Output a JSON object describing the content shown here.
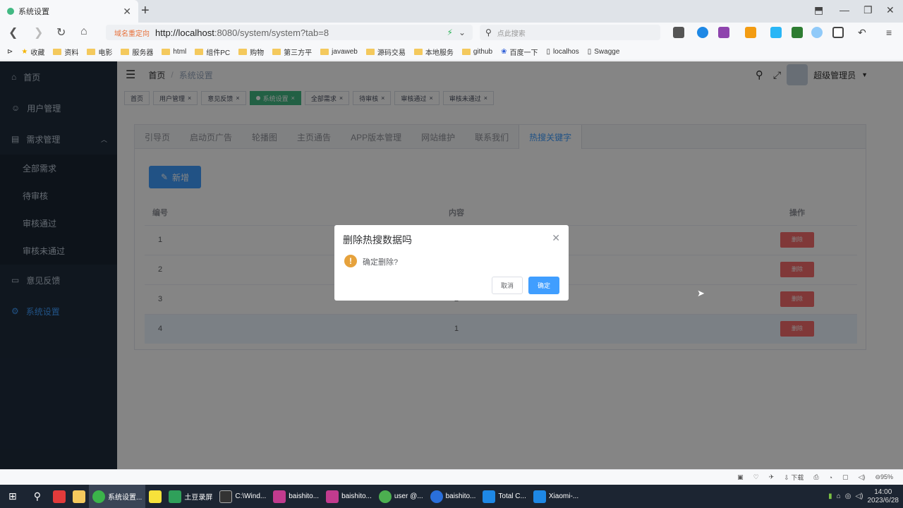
{
  "browser": {
    "tab_title": "系统设置",
    "redirect_label": "域名重定向",
    "url_host": "http://localhost",
    "url_rest": ":8080/system/system?tab=8",
    "search_placeholder": "点此搜索",
    "bookmarks": [
      "收藏",
      "资料",
      "电影",
      "服务器",
      "html",
      "组件PC",
      "购物",
      "第三方平",
      "javaweb",
      "源码交易",
      "本地服务",
      "github",
      "百度一下",
      "localhos",
      "Swagge"
    ]
  },
  "sidebar": {
    "items": [
      {
        "label": "首页",
        "icon": "home-icon"
      },
      {
        "label": "用户管理",
        "icon": "user-icon"
      },
      {
        "label": "需求管理",
        "icon": "document-icon"
      }
    ],
    "sub_items": [
      "全部需求",
      "待审核",
      "审核通过",
      "审核未通过"
    ],
    "items_after": [
      {
        "label": "意见反馈",
        "icon": "chat-icon"
      },
      {
        "label": "系统设置",
        "icon": "settings-icon"
      }
    ]
  },
  "navbar": {
    "breadcrumb_home": "首页",
    "breadcrumb_sep": "/",
    "breadcrumb_current": "系统设置",
    "user_name": "超级管理员"
  },
  "tags": [
    "首页",
    "用户管理",
    "意见反馈",
    "系统设置",
    "全部需求",
    "待审核",
    "审核通过",
    "审核未通过"
  ],
  "subtabs": [
    "引导页",
    "启动页广告",
    "轮播图",
    "主页通告",
    "APP版本管理",
    "网站维护",
    "联系我们",
    "热搜关键字"
  ],
  "toolbar": {
    "add_label": "新增"
  },
  "table": {
    "headers": {
      "id": "编号",
      "content": "内容",
      "actions": "操作"
    },
    "rows": [
      {
        "id": "1",
        "content": "",
        "action": "删除"
      },
      {
        "id": "2",
        "content": "",
        "action": "删除"
      },
      {
        "id": "3",
        "content": "2",
        "action": "删除"
      },
      {
        "id": "4",
        "content": "1",
        "action": "删除"
      }
    ]
  },
  "dialog": {
    "title": "删除热搜数据吗",
    "message": "确定删除?",
    "cancel": "取消",
    "confirm": "确定"
  },
  "statusbar": {
    "download": "下载",
    "zoom": "95%"
  },
  "taskbar": {
    "apps": [
      {
        "label": "系统设置...",
        "color": "#3bb44a"
      },
      {
        "label": "土豆录屏",
        "color": "#2fa05a"
      },
      {
        "label": "C:\\Wind...",
        "color": "#333"
      },
      {
        "label": "baishito...",
        "color": "#c23b8e"
      },
      {
        "label": "baishito...",
        "color": "#c23b8e"
      },
      {
        "label": "user @...",
        "color": "#4caf50"
      },
      {
        "label": "baishito...",
        "color": "#2a6fdb"
      },
      {
        "label": "Total C...",
        "color": "#1e88e5"
      },
      {
        "label": "Xiaomi-...",
        "color": "#1e88e5"
      }
    ],
    "time": "14:00",
    "date": "2023/6/28"
  },
  "colors": {
    "primary": "#409eff",
    "danger": "#f56c6c",
    "sidebar": "#1f2d3d",
    "tag_active": "#42b983"
  }
}
